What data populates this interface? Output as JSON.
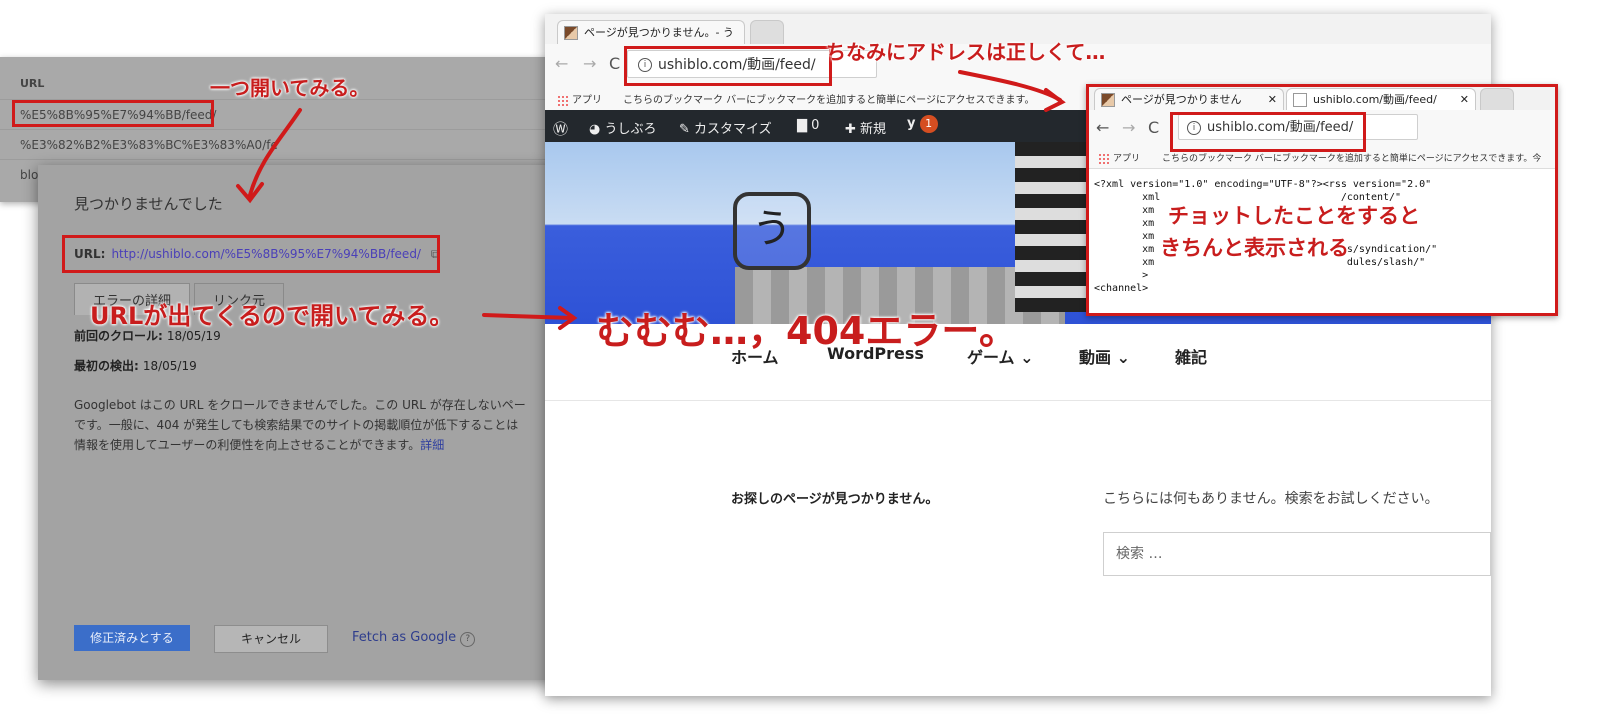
{
  "search_console": {
    "table": {
      "header": "URL",
      "rows": [
        "%E5%8B%95%E7%94%BB/feed/",
        "%E3%82%B2%E3%83%BC%E3%83%A0/fe",
        "blo"
      ]
    },
    "dialog": {
      "title": "見つかりませんでした",
      "url_label": "URL:",
      "url_value": "http://ushiblo.com/%E5%8B%95%E7%94%BB/feed/",
      "tabs": [
        "エラーの詳細",
        "リンク元"
      ],
      "last_crawl_label": "前回のクロール:",
      "last_crawl_value": "18/05/19",
      "first_detected_label": "最初の検出:",
      "first_detected_value": "18/05/19",
      "description": "Googlebot はこの URL をクロールできませんでした。この URL が存在しないペー",
      "description2": "です。一般に、404 が発生しても検索結果でのサイトの掲載順位が低下することは",
      "description3": "情報を使用してユーザーの利便性を向上させることができます。",
      "details_link": "詳細",
      "buttons": {
        "mark_fixed": "修正済みとする",
        "cancel": "キャンセル",
        "fetch": "Fetch as Google"
      }
    }
  },
  "browser": {
    "tab_title": "ページが見つかりません。- う",
    "address": "ushiblo.com/動画/feed/",
    "bookmarks_apps": "アプリ",
    "bookmarks_text": "こちらのブックマーク バーにブックマークを追加すると簡単にページにアクセスできます。",
    "wp_bar": {
      "site_name": "うしぶろ",
      "customize": "カスタマイズ",
      "comments": "0",
      "new": "新規",
      "notification_count": "1"
    },
    "logo_text": "う",
    "menu": [
      "ホーム",
      "WordPress",
      "ゲーム ⌄",
      "動画 ⌄",
      "雑記"
    ],
    "not_found_text": "お探しのページが見つかりません。",
    "nothing_here": "こちらには何もありません。検索をお試しください。",
    "search_placeholder": "検索 …"
  },
  "inner_browser": {
    "tab1_title": "ページが見つかりません",
    "tab2_title": "ushiblo.com/動画/feed/",
    "address": "ushiblo.com/動画/feed/",
    "bookmarks_apps": "アプリ",
    "bookmarks_text": "こちらのブックマーク バーにブックマークを追加すると簡単にページにアクセスできます。今",
    "xml_lines": [
      "<?xml version=\"1.0\" encoding=\"UTF-8\"?><rss version=\"2.0\"",
      "        xml                              /content/\"",
      "        xm",
      "        xm",
      "        xm",
      "        xm                                s/syndication/\"",
      "        xm                                dules/slash/\"",
      "        >",
      "",
      "<channel>"
    ]
  },
  "annotations": {
    "open_one": "一つ開いてみる。",
    "url_appears": "URLが出てくるので開いてみる。",
    "error_404": "むむむ…，404エラー。",
    "address_correct": "ちなみにアドレスは正しくて…",
    "tweak": "チョットしたことをすると",
    "displays": "きちんと表示される"
  },
  "colors": {
    "annotation_red": "#d01a1a",
    "wp_bar": "#23282d",
    "primary_button": "#3b6ec9"
  }
}
